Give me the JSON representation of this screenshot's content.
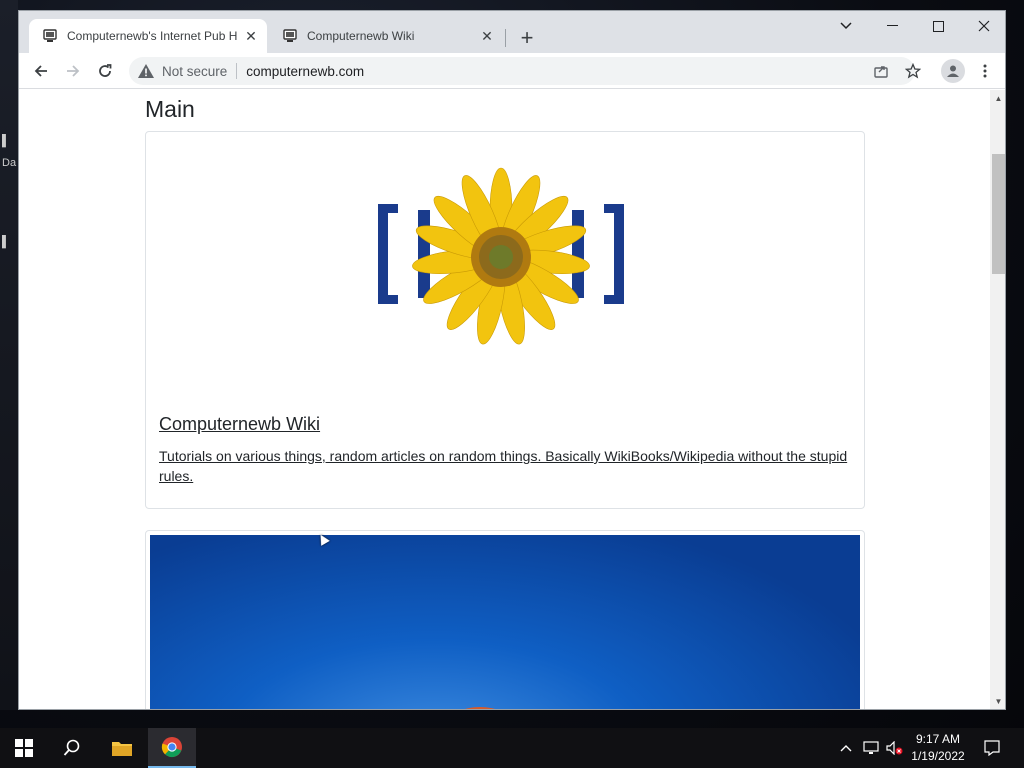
{
  "browser": {
    "tabs": [
      {
        "label": "Computernewb's Internet Pub Hub",
        "active": true
      },
      {
        "label": "Computernewb Wiki",
        "active": false
      }
    ],
    "address": {
      "security_label": "Not secure",
      "url": "computernewb.com"
    }
  },
  "page": {
    "heading": "Main",
    "cards": [
      {
        "title": "Computernewb Wiki",
        "description": "Tutorials on various things, random articles on random things. Basically WikiBooks/Wikipedia without the stupid rules."
      }
    ]
  },
  "desktop": {
    "side_label": "Da"
  },
  "taskbar": {
    "time": "9:17 AM",
    "date": "1/19/2022"
  },
  "colors": {
    "tabstrip": "#dee1e6",
    "taskbar": "#101013",
    "logo_blue": "#1a3b8c",
    "sunflower": "#f2c40f"
  }
}
